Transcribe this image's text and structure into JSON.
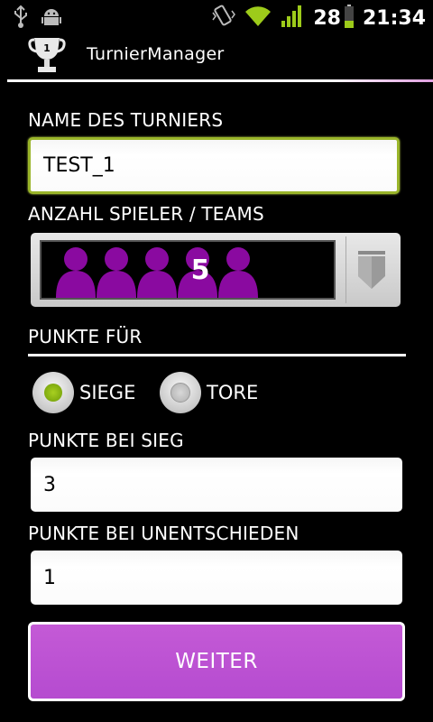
{
  "status_bar": {
    "battery_percent": "28",
    "time": "21:34",
    "icons": [
      "usb-icon",
      "android-debug-icon",
      "vibrate-icon",
      "wifi-icon",
      "signal-icon",
      "battery-icon"
    ]
  },
  "app": {
    "title": "TurnierManager",
    "icon": "trophy-icon",
    "trophy_number": "1"
  },
  "form": {
    "name_label": "NAME DES TURNIERS",
    "name_value": "TEST_1",
    "players_label": "ANZAHL SPIELER / TEAMS",
    "players_value": "5",
    "points_for_label": "PUNKTE FÜR",
    "radio_options": [
      {
        "label": "SIEGE",
        "selected": true
      },
      {
        "label": "TORE",
        "selected": false
      }
    ],
    "win_points_label": "PUNKTE BEI SIEG",
    "win_points_value": "3",
    "draw_points_label": "PUNKTE BEI UNENTSCHIEDEN",
    "draw_points_value": "1",
    "next_button": "WEITER"
  },
  "colors": {
    "accent_purple": "#b54bd0",
    "person_purple": "#8a0aa0",
    "focus_green": "#9ab52a",
    "radio_selected": "#8fb51a"
  }
}
